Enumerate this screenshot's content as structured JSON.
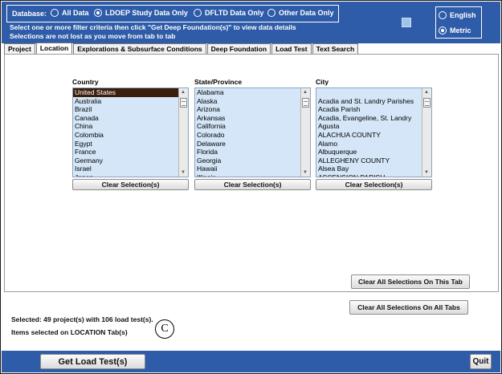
{
  "database": {
    "label": "Database:",
    "options": [
      {
        "label": "All Data",
        "selected": false
      },
      {
        "label": "LDOEP Study Data  Only",
        "selected": true
      },
      {
        "label": "DFLTD Data Only",
        "selected": false
      },
      {
        "label": "Other Data Only",
        "selected": false
      }
    ]
  },
  "instructions": {
    "line1": "Select one or more filter criteria then click \"Get Deep Foundation(s)\" to view data details",
    "line2": "Selections are not lost as you move from tab to tab"
  },
  "units": {
    "options": [
      {
        "label": "English",
        "selected": false
      },
      {
        "label": "Metric",
        "selected": true
      }
    ]
  },
  "tabs": [
    {
      "label": "Project",
      "active": false
    },
    {
      "label": "Location",
      "active": true
    },
    {
      "label": "Explorations & Subsurface Conditions",
      "active": false
    },
    {
      "label": "Deep Foundation",
      "active": false
    },
    {
      "label": "Load Test",
      "active": false
    },
    {
      "label": "Text Search",
      "active": false
    }
  ],
  "lists": {
    "country": {
      "title": "Country",
      "items": [
        "United States",
        "Australia",
        "Brazil",
        "Canada",
        "China",
        "Colombia",
        "Egypt",
        "France",
        "Germany",
        "Israel",
        "Japan"
      ],
      "selected": "United States",
      "clear_label": "Clear Selection(s)"
    },
    "state": {
      "title": "State/Province",
      "items": [
        "Alabama",
        "Alaska",
        "Arizona",
        "Arkansas",
        "California",
        "Colorado",
        "Delaware",
        "Florida",
        "Georgia",
        "Hawaii",
        "Illinois"
      ],
      "selected": "",
      "clear_label": "Clear Selection(s)"
    },
    "city": {
      "title": "City",
      "items": [
        "",
        "Acadia and St. Landry Parishes",
        "Acadia Parish",
        "Acadia, Evangeline, St. Landry",
        "Agusta",
        "ALACHUA COUNTY",
        "Alamo",
        "Albuquerque",
        "ALLEGHENY COUNTY",
        "Alsea Bay",
        "ASCENSION PARISH"
      ],
      "selected": "",
      "clear_label": "Clear Selection(s)"
    }
  },
  "actions": {
    "clear_tab": "Clear All Selections On This Tab",
    "clear_all": "Clear All Selections On All Tabs",
    "get_load_tests": "Get Load Test(s)",
    "quit": "Quit"
  },
  "status": {
    "line1": "Selected: 49 project(s) with 106 load test(s).",
    "line2": "Items selected on LOCATION Tab(s)"
  },
  "annotation_letter": "C",
  "colors": {
    "bar": "#2e5ca8",
    "list_bg": "#d4e6f7",
    "selected_row": "#3b1e0c"
  }
}
